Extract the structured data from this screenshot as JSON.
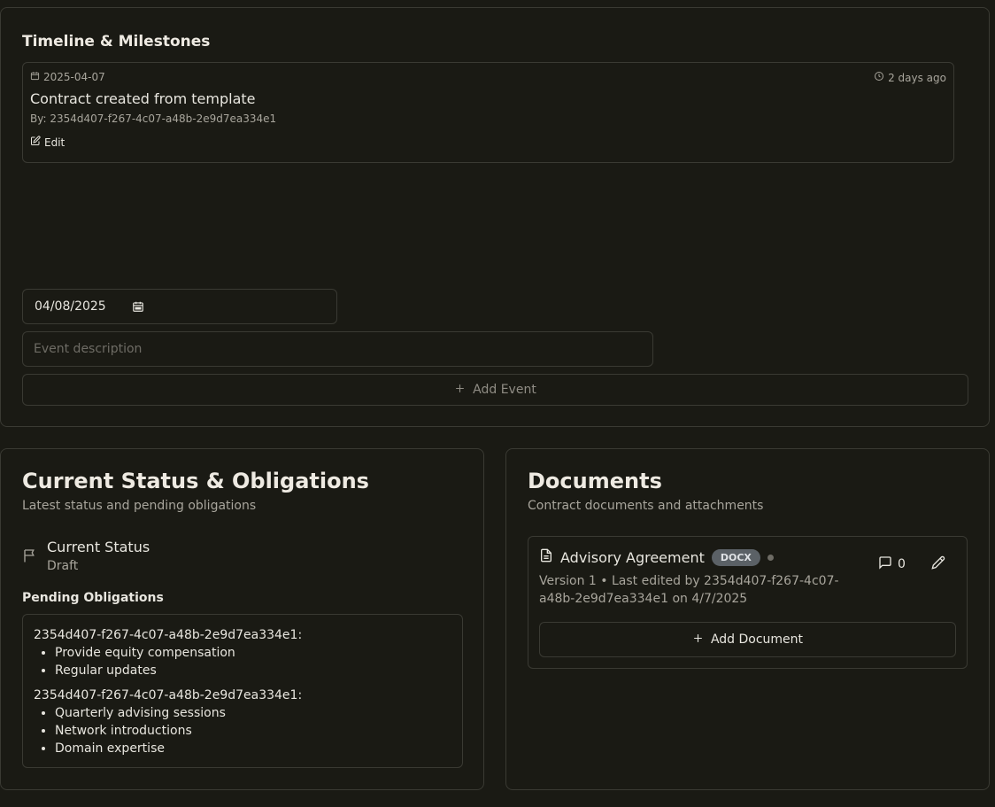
{
  "timeline": {
    "title": "Timeline & Milestones",
    "events": [
      {
        "date": "2025-04-07",
        "ago": "2 days ago",
        "title": "Contract created from template",
        "by": "By: 2354d407-f267-4c07-a48b-2e9d7ea334e1",
        "edit_label": "Edit"
      }
    ],
    "date_input_value": "04/08/2025",
    "description_placeholder": "Event description",
    "add_event_label": "Add Event"
  },
  "status": {
    "title": "Current Status & Obligations",
    "subtitle": "Latest status and pending obligations",
    "current_status_label": "Current Status",
    "current_status_value": "Draft",
    "pending_title": "Pending Obligations",
    "obligations": [
      {
        "party": "2354d407-f267-4c07-a48b-2e9d7ea334e1:",
        "items": [
          "Provide equity compensation",
          "Regular updates"
        ]
      },
      {
        "party": "2354d407-f267-4c07-a48b-2e9d7ea334e1:",
        "items": [
          "Quarterly advising sessions",
          "Network introductions",
          "Domain expertise"
        ]
      }
    ]
  },
  "documents": {
    "title": "Documents",
    "subtitle": "Contract documents and attachments",
    "items": [
      {
        "name": "Advisory Agreement",
        "type_badge": "DOCX",
        "meta": "Version 1 • Last edited by 2354d407-f267-4c07-a48b-2e9d7ea334e1 on 4/7/2025",
        "comment_count": "0"
      }
    ],
    "add_document_label": "Add Document"
  },
  "icons": {
    "calendar": "calendar-icon",
    "clock": "clock-icon",
    "edit": "edit-icon",
    "plus": "plus-icon",
    "flag": "flag-icon",
    "file": "file-icon",
    "comment": "comment-icon",
    "pencil": "pencil-icon"
  },
  "colors": {
    "background": "#1a1a14",
    "border": "#3a3a33",
    "muted_text": "#a8a59c",
    "badge_bg": "#5b6166"
  }
}
